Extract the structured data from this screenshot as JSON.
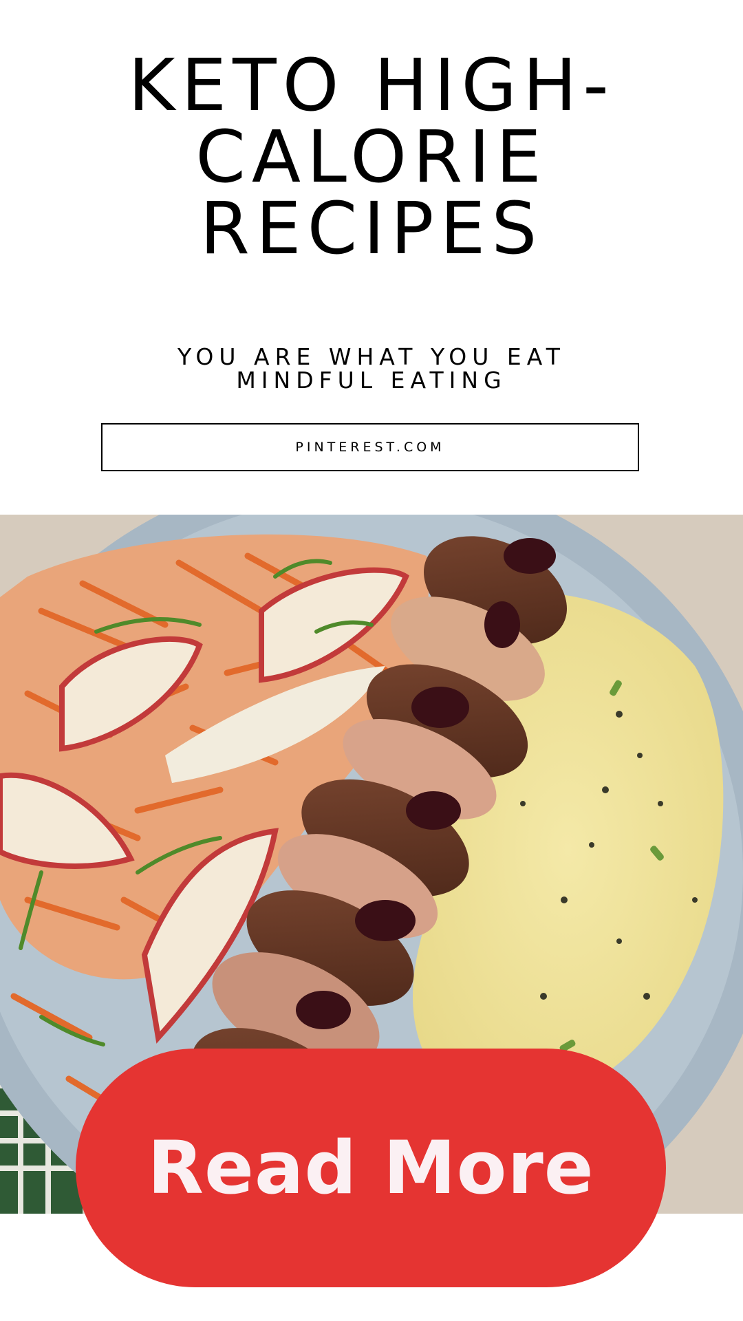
{
  "header": {
    "title_lines": [
      "KETO HIGH-",
      "CALORIE",
      "RECIPES"
    ],
    "subtitle_lines": [
      "YOU ARE WHAT YOU EAT",
      "MINDFUL EATING"
    ]
  },
  "source": {
    "label": "PINTEREST.COM"
  },
  "cta": {
    "label": "Read More",
    "color": "#e53432",
    "text_color": "#fbf0f3"
  }
}
